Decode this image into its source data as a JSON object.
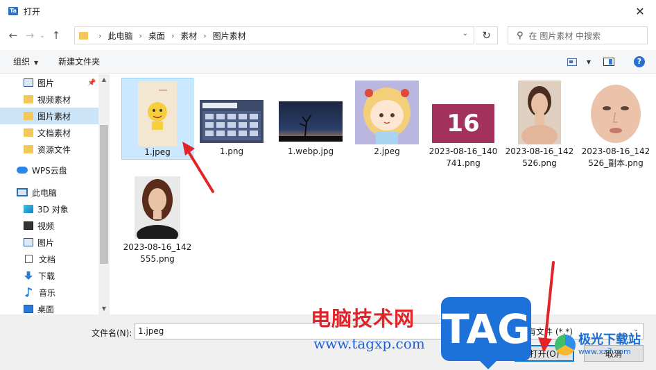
{
  "window": {
    "title": "打开",
    "app_icon_text": "Ta",
    "close_symbol": "✕"
  },
  "nav": {
    "breadcrumbs": [
      "此电脑",
      "桌面",
      "素材",
      "图片素材"
    ],
    "search_placeholder": "在 图片素材 中搜索"
  },
  "toolbar": {
    "organize_label": "组织",
    "new_folder_label": "新建文件夹",
    "help_label": "?"
  },
  "sidebar": {
    "items": [
      {
        "label": "图片",
        "icon": "picture-icon",
        "pinned": true
      },
      {
        "label": "视频素材",
        "icon": "folder-icon"
      },
      {
        "label": "图片素材",
        "icon": "folder-icon",
        "selected": true
      },
      {
        "label": "文档素材",
        "icon": "folder-icon"
      },
      {
        "label": "资源文件",
        "icon": "folder-icon"
      },
      {
        "label": "WPS云盘",
        "icon": "cloud-icon"
      },
      {
        "label": "此电脑",
        "icon": "computer-icon"
      },
      {
        "label": "3D 对象",
        "icon": "3d-objects-icon"
      },
      {
        "label": "视频",
        "icon": "video-icon"
      },
      {
        "label": "图片",
        "icon": "picture-icon"
      },
      {
        "label": "文档",
        "icon": "document-icon"
      },
      {
        "label": "下载",
        "icon": "download-icon"
      },
      {
        "label": "音乐",
        "icon": "music-icon"
      },
      {
        "label": "桌面",
        "icon": "desktop-icon"
      }
    ]
  },
  "files": [
    {
      "name_line1": "1.jpeg",
      "name_line2": "",
      "selected": true
    },
    {
      "name_line1": "1.png",
      "name_line2": ""
    },
    {
      "name_line1": "1.webp.jpg",
      "name_line2": ""
    },
    {
      "name_line1": "2.jpeg",
      "name_line2": ""
    },
    {
      "name_line1": "2023-08-16_140",
      "name_line2": "741.png",
      "thumb_text": "16"
    },
    {
      "name_line1": "2023-08-16_142",
      "name_line2": "526.png"
    },
    {
      "name_line1": "2023-08-16_142",
      "name_line2": "526_副本.png"
    },
    {
      "name_line1": "2023-08-16_142",
      "name_line2": "555.png"
    }
  ],
  "bottom": {
    "filename_label": "文件名(N):",
    "filename_value": "1.jpeg",
    "filetype_value": "所有文件 (*.*)",
    "open_label": "打开(O)",
    "cancel_label": "取消"
  },
  "watermarks": {
    "site_cn": "电脑技术网",
    "site_url": "www.tagxp.com",
    "tag_text": "TAG",
    "brand_cn": "极光下载站",
    "brand_url": "www.xz7.com"
  },
  "colors": {
    "accent": "#0078d7",
    "selection": "#cce8ff",
    "arrow": "#e0242a"
  }
}
